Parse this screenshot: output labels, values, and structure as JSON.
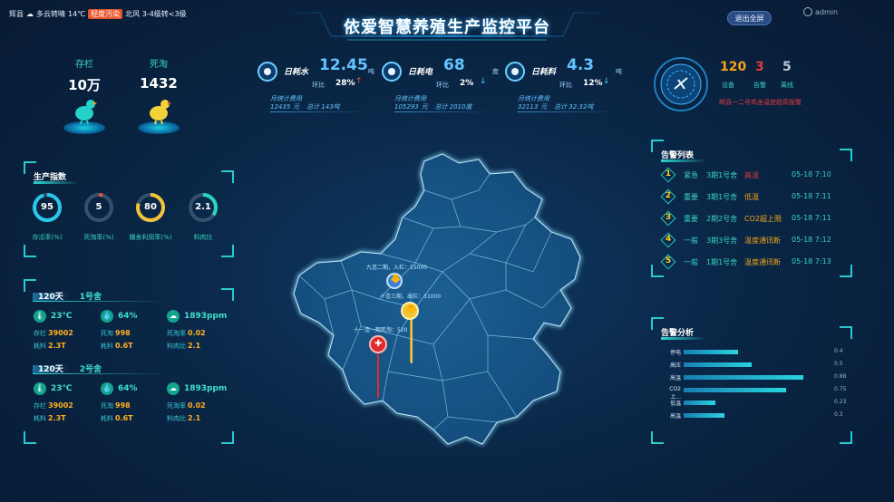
{
  "header": {
    "weather": {
      "city": "辉县",
      "condition": "多云转晴",
      "temp": "14℃",
      "alert": "轻度污染",
      "wind": "北风 3-4级转<3级"
    },
    "title": "依爱智慧养殖生产监控平台",
    "fullscreen_label": "退出全屏",
    "user": "admin"
  },
  "stock": {
    "label": "存栏",
    "value": "10万"
  },
  "death": {
    "label": "死淘",
    "value": "1432"
  },
  "consumption": [
    {
      "label": "日耗水",
      "value": "12.45",
      "unit": "吨",
      "ring_label": "环比",
      "ring_pct": "28%",
      "dir": "up",
      "month_label": "月统计费用",
      "month_cost": "12435",
      "month_cost_unit": "元",
      "month_total_label": "总计",
      "month_total": "143吨"
    },
    {
      "label": "日耗电",
      "value": "68",
      "unit": "度",
      "ring_label": "环比",
      "ring_pct": "2%",
      "dir": "down",
      "month_label": "月统计费用",
      "month_cost": "105293",
      "month_cost_unit": "元",
      "month_total_label": "总计",
      "month_total": "2010度"
    },
    {
      "label": "日耗料",
      "value": "4.3",
      "unit": "吨",
      "ring_label": "环比",
      "ring_pct": "12%",
      "dir": "down",
      "month_label": "月统计费用",
      "month_cost": "32113",
      "month_cost_unit": "元",
      "month_total_label": "总计",
      "month_total": "32.32吨"
    }
  ],
  "devices": {
    "device_count": "120",
    "device_label": "设备",
    "alarm_count": "3",
    "alarm_label": "告警",
    "offline_count": "5",
    "offline_label": "离线",
    "warn_text": "辉县一二号鸡舍温度超高报警",
    "colors": {
      "device": "#f4a417",
      "alarm": "#e23a3a",
      "offline": "#bcc7d4"
    }
  },
  "production": {
    "title": "生产指数",
    "rings": [
      {
        "value": "95",
        "label": "存活率(%)",
        "fill": 0.95,
        "color": "#28c8e8"
      },
      {
        "value": "5",
        "label": "死淘率(%)",
        "fill": 0.05,
        "color": "#e8552f"
      },
      {
        "value": "80",
        "label": "棚舍利用率(%)",
        "fill": 0.8,
        "color": "#f2c43a"
      },
      {
        "value": "2.1",
        "label": "料肉比",
        "fill": 0.35,
        "color": "#2ad4c0"
      }
    ]
  },
  "houses": [
    {
      "days": "120天",
      "name": "1号舍",
      "temp": "23℃",
      "humidity": "64%",
      "co2": "1893ppm",
      "stock_label": "存栏",
      "stock": "39002",
      "death_label": "死淘",
      "death": "998",
      "death_rate_label": "死淘率",
      "death_rate": "0.02",
      "feed_label": "耗料",
      "feed": "2.3T",
      "feed2_label": "耗料",
      "feed2": "0.6T",
      "fcr_label": "料肉比",
      "fcr": "2.1"
    },
    {
      "days": "120天",
      "name": "2号舍",
      "temp": "23℃",
      "humidity": "64%",
      "co2": "1893ppm",
      "stock_label": "存栏",
      "stock": "39002",
      "death_label": "死淘",
      "death": "998",
      "death_rate_label": "死淘率",
      "death_rate": "0.02",
      "feed_label": "耗料",
      "feed": "2.3T",
      "feed2_label": "耗料",
      "feed2": "0.6T",
      "fcr_label": "料肉比",
      "fcr": "2.1"
    }
  ],
  "alarms": {
    "title": "告警列表",
    "rows": [
      {
        "num": "1",
        "level": "紧急",
        "location": "3期1号舍",
        "type": "高温",
        "type_color": "#e23a3a",
        "time": "05-18 7:10"
      },
      {
        "num": "2",
        "level": "重要",
        "location": "3期1号舍",
        "type": "低温",
        "type_color": "#f4a417",
        "time": "05-18 7:11"
      },
      {
        "num": "3",
        "level": "重要",
        "location": "2期2号舍",
        "type": "CO2超上限",
        "type_color": "#f4a417",
        "time": "05-18 7:11"
      },
      {
        "num": "4",
        "level": "一般",
        "location": "3期3号舍",
        "type": "温度通讯断",
        "type_color": "#f4a417",
        "time": "05-18 7:12"
      },
      {
        "num": "5",
        "level": "一般",
        "location": "1期1号舍",
        "type": "温度通讯断",
        "type_color": "#f4a417",
        "time": "05-18 7:13"
      }
    ]
  },
  "analysis": {
    "title": "告警分析",
    "items": [
      {
        "label": "停电",
        "value": "0.4"
      },
      {
        "label": "高压",
        "value": "0.5"
      },
      {
        "label": "高温",
        "value": "0.88"
      },
      {
        "label": "CO2上...",
        "value": "0.75"
      },
      {
        "label": "低温",
        "value": "0.23"
      },
      {
        "label": "高温",
        "value": "0.3"
      }
    ]
  },
  "map": {
    "pins": [
      {
        "text": "九连二期，入栏：15000",
        "icon": "chicken-icon",
        "color": "#3a7fe0"
      },
      {
        "text": "十连三期，出栏：31000",
        "icon": "chicken-icon",
        "color": "#f2c43a"
      },
      {
        "text": "十一连一期死淘：520",
        "icon": "hospital-icon",
        "color": "#e02a2a"
      }
    ]
  }
}
